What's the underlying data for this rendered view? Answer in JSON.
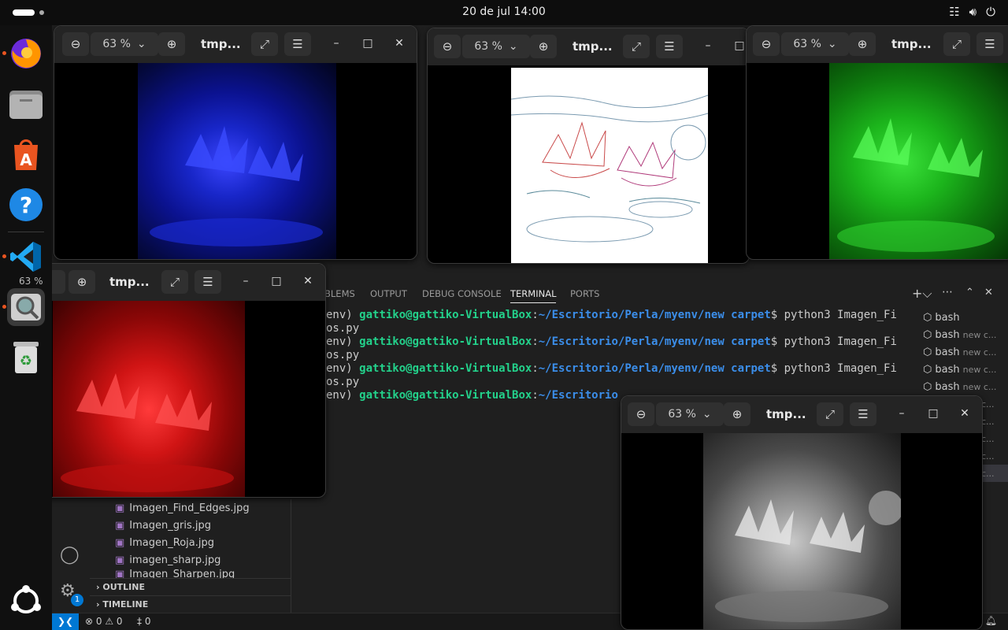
{
  "topbar": {
    "clock": "20 de jul  14:00"
  },
  "dock": {
    "items": [
      "Firefox",
      "Files",
      "App Center",
      "Help",
      "Visual Studio Code",
      "Image Viewer",
      "Trash",
      "Show Apps"
    ],
    "code_badge": "1"
  },
  "viewer": {
    "zoom": "63 %",
    "title": "tmp...",
    "windows": [
      {
        "name": "blue-image-window",
        "filter": "Blue channel"
      },
      {
        "name": "edges-image-window",
        "filter": "Find edges"
      },
      {
        "name": "green-image-window",
        "filter": "Green channel"
      },
      {
        "name": "red-image-window",
        "filter": "Red channel"
      },
      {
        "name": "gray-image-window",
        "filter": "Grayscale"
      }
    ]
  },
  "panel": {
    "tabs": [
      "BLEMS",
      "OUTPUT",
      "DEBUG CONSOLE",
      "TERMINAL",
      "PORTS"
    ],
    "active_tab": "TERMINAL"
  },
  "terminal": {
    "user_host": "gattiko@gattiko-VirtualBox",
    "path": "~/Escritorio/Perla/myenv/new carpet",
    "path_partial": "~/Escritorio",
    "command": "python3 Imagen_Fi",
    "wrap": "os.py",
    "prefix": "env) "
  },
  "terminals_list": [
    "bash",
    "bash",
    "bash",
    "bash",
    "bash"
  ],
  "terminals_sub": "new c...",
  "terminals_more": [
    "c...",
    "c...",
    "c...",
    "c...",
    "c..."
  ],
  "explorer": {
    "files": [
      "Imagen_Find_Edges.jpg",
      "Imagen_gris.jpg",
      "Imagen_Roja.jpg",
      "imagen_sharp.jpg",
      "Imagen_Sharpen.jpg"
    ],
    "outline": "OUTLINE",
    "timeline": "TIMELINE"
  },
  "statusbar": {
    "errors": "0",
    "warnings": "0",
    "ports": "0"
  },
  "colors": {
    "accent": "#0078d4",
    "ubuntu": "#e95420",
    "term_green": "#23d18b",
    "term_blue": "#3b8eea"
  }
}
